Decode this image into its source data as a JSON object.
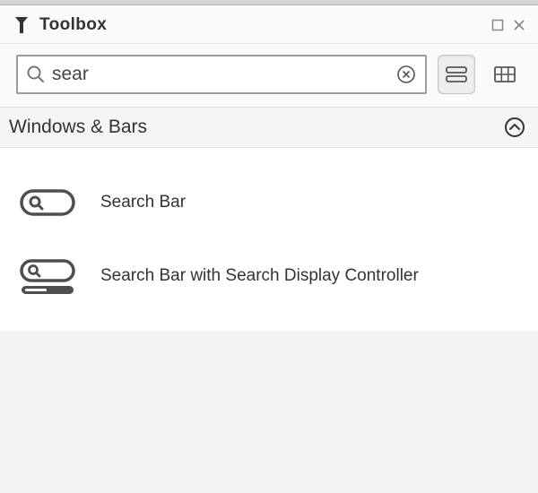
{
  "panel": {
    "title": "Toolbox"
  },
  "search": {
    "value": "sear",
    "placeholder": ""
  },
  "section": {
    "title": "Windows & Bars"
  },
  "results": [
    {
      "label": "Search Bar"
    },
    {
      "label": "Search Bar with Search Display Controller"
    }
  ]
}
